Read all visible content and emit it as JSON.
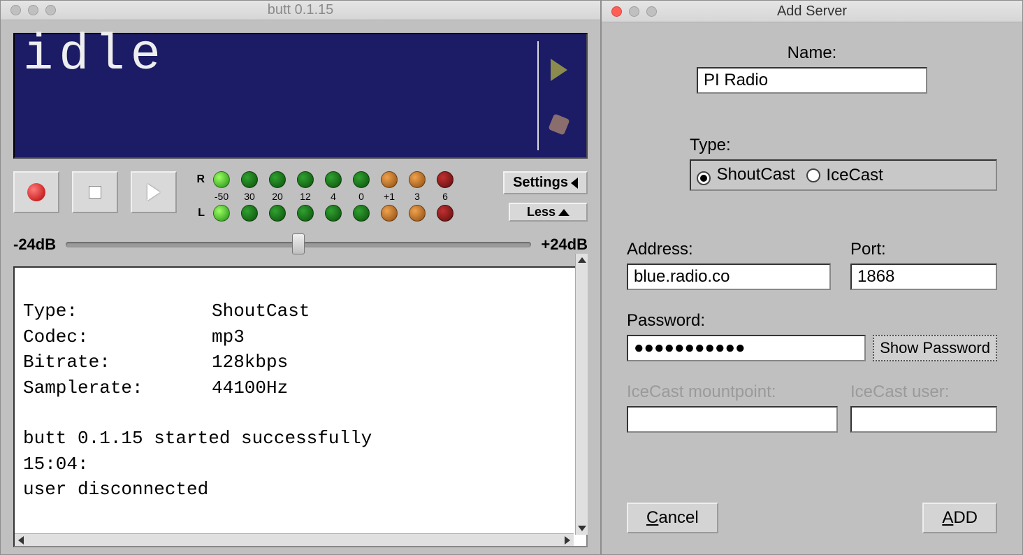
{
  "main": {
    "title": "butt 0.1.15",
    "lcd_status": "idle",
    "meter": {
      "labels": [
        "-50",
        "30",
        "20",
        "12",
        "4",
        "0",
        "+1",
        "3",
        "6"
      ]
    },
    "buttons": {
      "settings": "Settings",
      "less": "Less"
    },
    "slider": {
      "min_label": "-24dB",
      "max_label": "+24dB"
    },
    "log": {
      "kv": [
        {
          "k": "Type:",
          "v": "ShoutCast"
        },
        {
          "k": "Codec:",
          "v": "mp3"
        },
        {
          "k": "Bitrate:",
          "v": "128kbps"
        },
        {
          "k": "Samplerate:",
          "v": "44100Hz"
        }
      ],
      "lines": [
        "",
        "butt 0.1.15 started successfully",
        "15:04:",
        "user disconnected"
      ]
    }
  },
  "dialog": {
    "title": "Add Server",
    "name_label": "Name:",
    "name_value": "PI Radio",
    "type_label": "Type:",
    "type_shoutcast": "ShoutCast",
    "type_icecast": "IceCast",
    "address_label": "Address:",
    "address_value": "blue.radio.co",
    "port_label": "Port:",
    "port_value": "1868",
    "password_label": "Password:",
    "password_value": "●●●●●●●●●●●",
    "show_password": "Show Password",
    "mount_label": "IceCast mountpoint:",
    "mount_value": "",
    "iceuser_label": "IceCast user:",
    "iceuser_value": "",
    "cancel_label": "Cancel",
    "cancel_u": "C",
    "cancel_rest": "ancel",
    "add_label": "ADD",
    "add_u": "A",
    "add_rest": "DD"
  }
}
